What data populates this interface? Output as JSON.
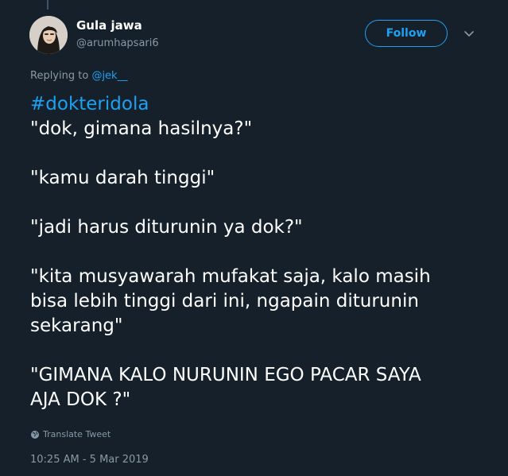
{
  "tweet": {
    "author": {
      "display_name": "Gula jawa",
      "handle": "@arumhapsari6"
    },
    "follow_label": "Follow",
    "replying_to": {
      "prefix": "Replying to",
      "mention": "@jek__"
    },
    "hashtag": "#dokteridola",
    "lines": {
      "l1": "\"dok, gimana hasilnya?\"",
      "l2": "\"kamu darah tinggi\"",
      "l3": "\"jadi harus diturunin ya dok?\"",
      "l4": "\"kita musyawarah mufakat saja, kalo masih",
      "l5": "bisa lebih tinggi dari ini, ngapain diturunin",
      "l6": "sekarang\"",
      "l7": "\"GIMANA KALO NURUNIN EGO PACAR SAYA",
      "l8": "AJA DOK ?\""
    },
    "translate_label": "Translate Tweet",
    "timestamp": "10:25 AM - 5 Mar 2019"
  },
  "colors": {
    "background": "#15202b",
    "accent": "#1da1f2",
    "secondary_text": "#8899a6"
  },
  "icons": {
    "avatar": "profile-photo",
    "caret": "chevron-down-icon",
    "translate": "globe-icon"
  }
}
